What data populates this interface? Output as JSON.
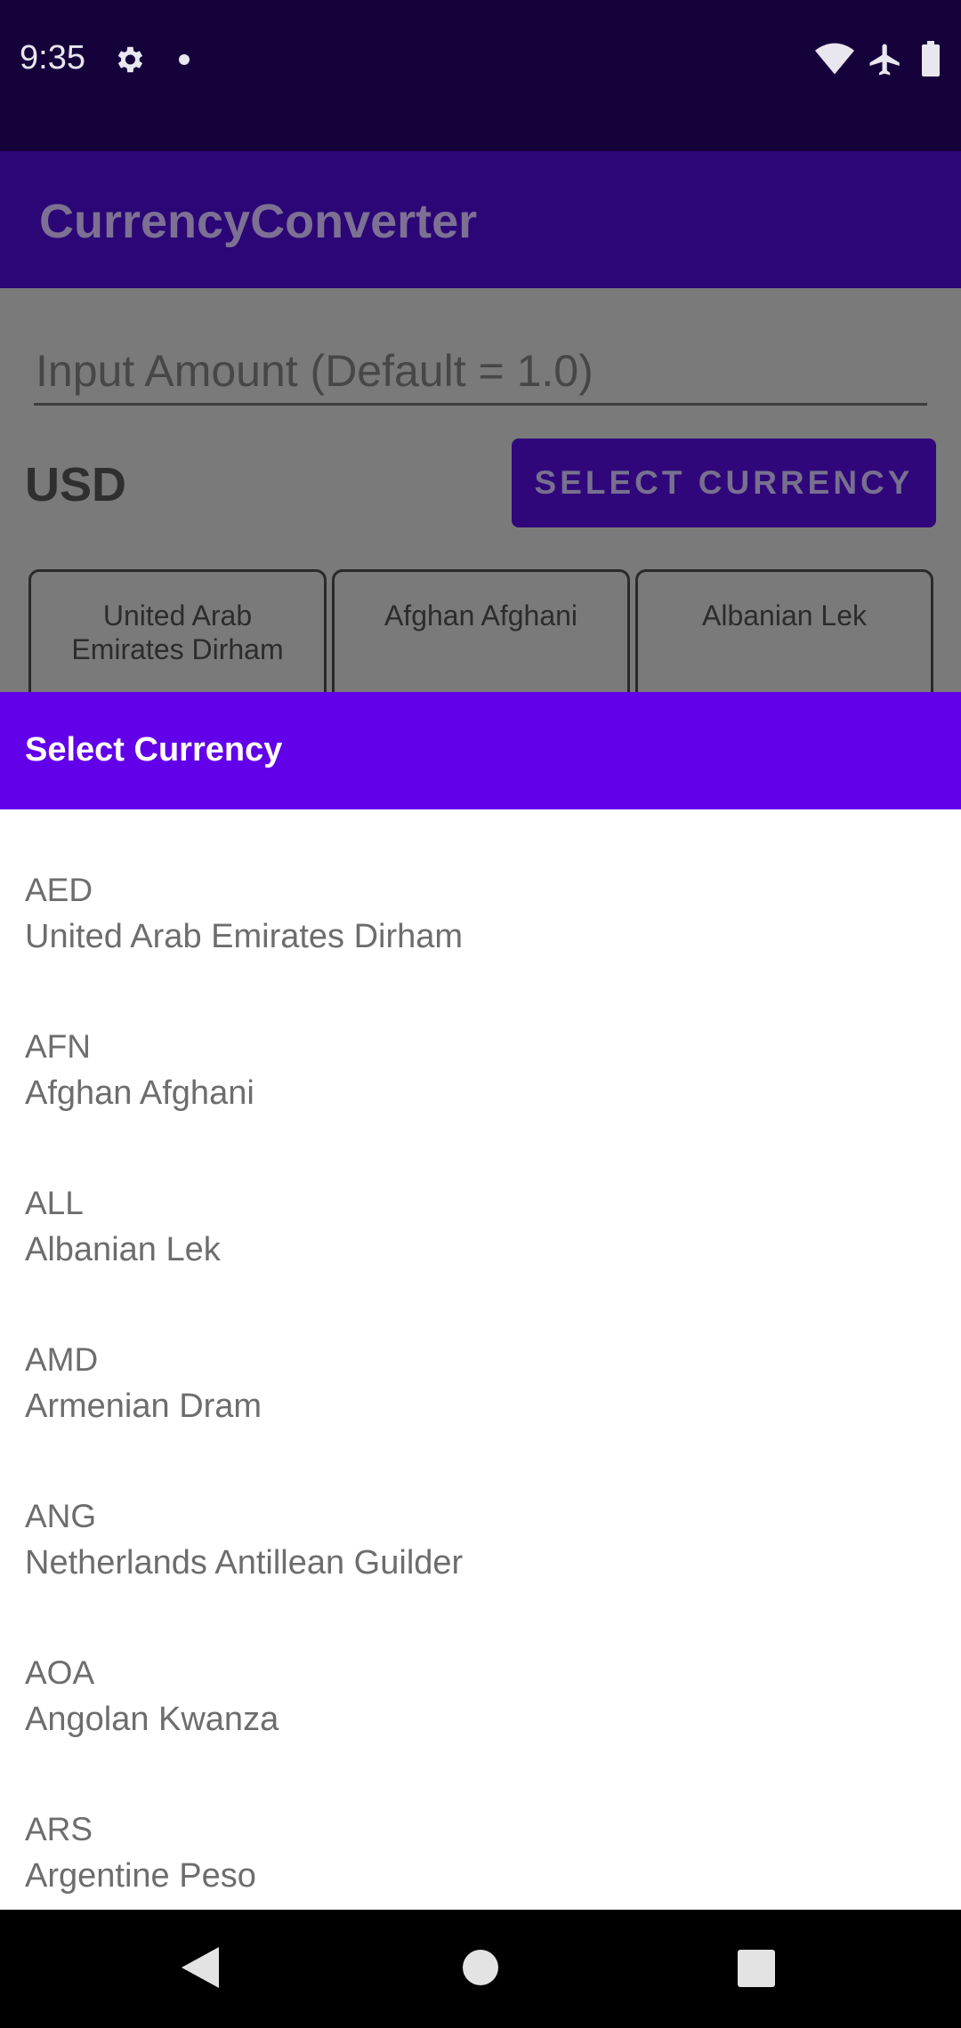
{
  "status_bar": {
    "time": "9:35",
    "icons": [
      "gear-icon",
      "notification-dot-icon",
      "wifi-icon",
      "airplane-icon",
      "battery-icon"
    ]
  },
  "app_bar": {
    "title": "CurrencyConverter"
  },
  "converter": {
    "amount_placeholder": "Input Amount (Default = 1.0)",
    "base_currency": "USD",
    "select_button_label": "SELECT CURRENCY",
    "rate_cards": [
      {
        "label": "United Arab Emirates Dirham"
      },
      {
        "label": "Afghan Afghani"
      },
      {
        "label": "Albanian Lek"
      }
    ]
  },
  "dialog": {
    "title": "Select Currency",
    "items": [
      {
        "code": "AED",
        "name": "United Arab Emirates Dirham"
      },
      {
        "code": "AFN",
        "name": "Afghan Afghani"
      },
      {
        "code": "ALL",
        "name": "Albanian Lek"
      },
      {
        "code": "AMD",
        "name": "Armenian Dram"
      },
      {
        "code": "ANG",
        "name": "Netherlands Antillean Guilder"
      },
      {
        "code": "AOA",
        "name": "Angolan Kwanza"
      },
      {
        "code": "ARS",
        "name": "Argentine Peso"
      }
    ]
  },
  "colors": {
    "status_bar": "#16023b",
    "app_bar_dimmed": "#2b0676",
    "dialog_header": "#6200ea",
    "scrim": "#7a7a7a"
  },
  "nav_bar": {
    "icons": [
      "back-icon",
      "home-icon",
      "recents-icon"
    ]
  }
}
